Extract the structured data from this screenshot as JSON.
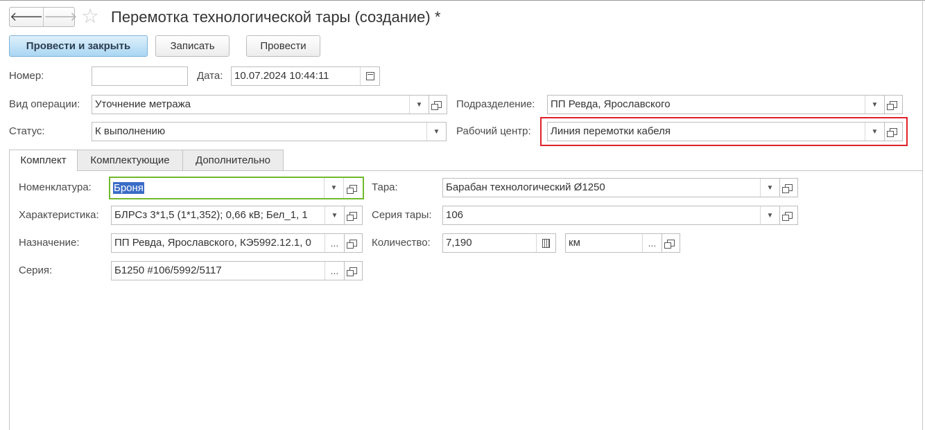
{
  "window": {
    "title": "Перемотка технологической тары (создание) *",
    "back_glyph": "🡐",
    "forward_glyph": "🡒",
    "favorite_glyph": "☆"
  },
  "toolbar": {
    "post_close_label": "Провести и закрыть",
    "save_label": "Записать",
    "post_label": "Провести"
  },
  "header": {
    "number_label": "Номер:",
    "number_value": "",
    "date_label": "Дата:",
    "date_value": "10.07.2024 10:44:11",
    "operation_label": "Вид операции:",
    "operation_value": "Уточнение метража",
    "division_label": "Подразделение:",
    "division_value": "ПП Ревда, Ярославского",
    "status_label": "Статус:",
    "status_value": "К выполнению",
    "workcenter_label": "Рабочий центр:",
    "workcenter_value": "Линия перемотки кабеля"
  },
  "tabs": [
    {
      "label": "Комплект"
    },
    {
      "label": "Комплектующие"
    },
    {
      "label": "Дополнительно"
    }
  ],
  "kit": {
    "nomenclature_label": "Номенклатура:",
    "nomenclature_value": "Броня",
    "characteristic_label": "Характеристика:",
    "characteristic_value": "БЛРСз 3*1,5 (1*1,352); 0,66 кВ; Бел_1, 1",
    "purpose_label": "Назначение:",
    "purpose_value": "ПП Ревда, Ярославского, КЭ5992.12.1, 0",
    "series_label": "Серия:",
    "series_value": "Б1250 #106/5992/5117",
    "container_label": "Тара:",
    "container_value": "Барабан технологический Ø1250",
    "container_series_label": "Серия тары:",
    "container_series_value": "106",
    "quantity_label": "Количество:",
    "quantity_value": "7,190",
    "unit_value": "км"
  },
  "icons": {
    "dropdown": "▼",
    "dots": "..."
  },
  "colors": {
    "primary_button": "#a9d6f3",
    "highlight_red": "#e0202a",
    "focus_green": "#6fba2c",
    "selection": "#3b6cc7"
  }
}
